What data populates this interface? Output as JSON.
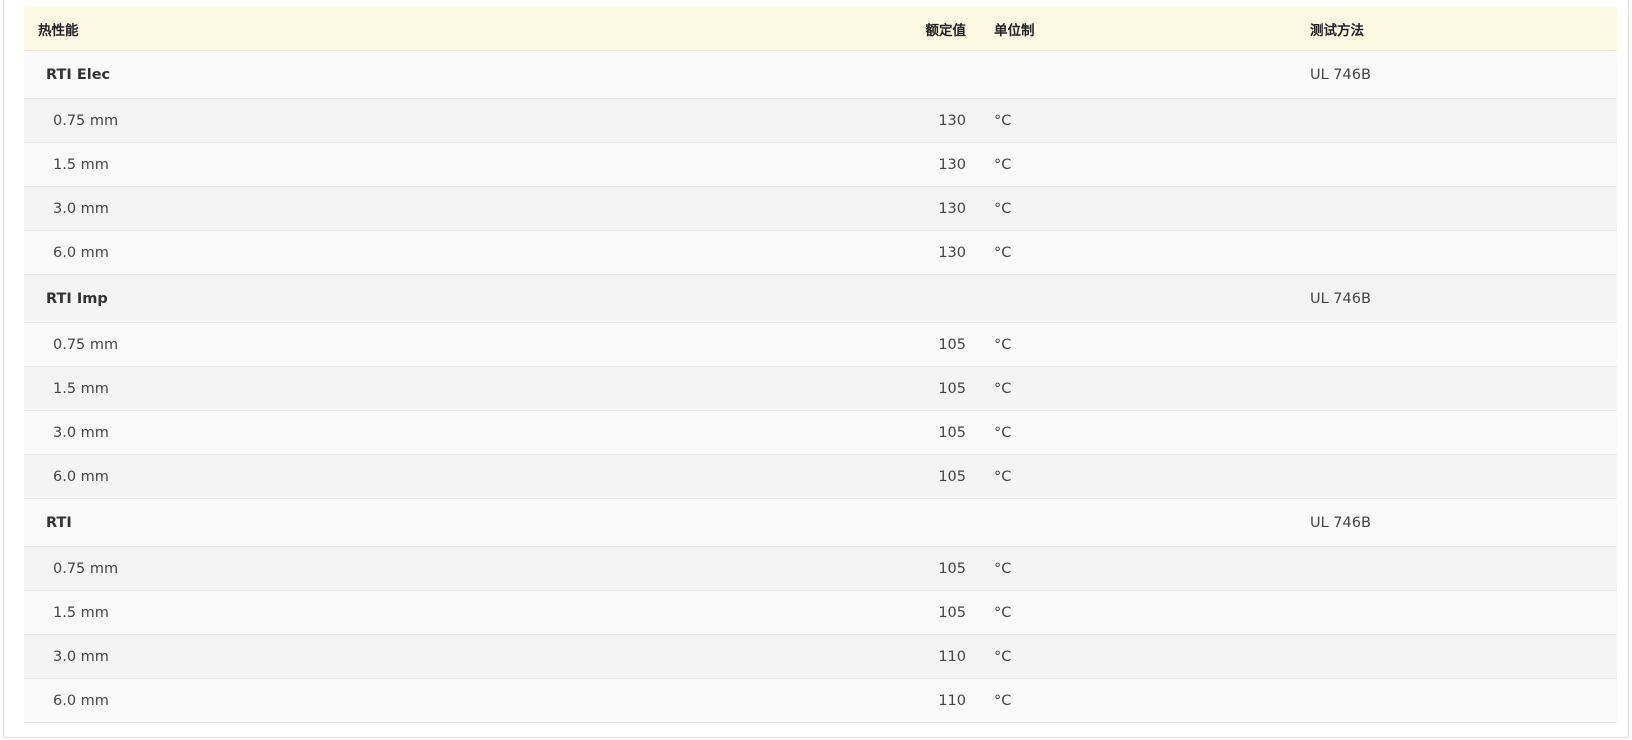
{
  "header": {
    "property": "热性能",
    "value": "额定值",
    "unit": "单位制",
    "method": "测试方法"
  },
  "groups": [
    {
      "name": "RTI Elec",
      "method": "UL 746B",
      "rows": [
        {
          "thickness": "0.75 mm",
          "value": "130",
          "unit": "°C"
        },
        {
          "thickness": "1.5 mm",
          "value": "130",
          "unit": "°C"
        },
        {
          "thickness": "3.0 mm",
          "value": "130",
          "unit": "°C"
        },
        {
          "thickness": "6.0 mm",
          "value": "130",
          "unit": "°C"
        }
      ]
    },
    {
      "name": "RTI Imp",
      "method": "UL 746B",
      "rows": [
        {
          "thickness": "0.75 mm",
          "value": "105",
          "unit": "°C"
        },
        {
          "thickness": "1.5 mm",
          "value": "105",
          "unit": "°C"
        },
        {
          "thickness": "3.0 mm",
          "value": "105",
          "unit": "°C"
        },
        {
          "thickness": "6.0 mm",
          "value": "105",
          "unit": "°C"
        }
      ]
    },
    {
      "name": "RTI",
      "method": "UL 746B",
      "rows": [
        {
          "thickness": "0.75 mm",
          "value": "105",
          "unit": "°C"
        },
        {
          "thickness": "1.5 mm",
          "value": "105",
          "unit": "°C"
        },
        {
          "thickness": "3.0 mm",
          "value": "110",
          "unit": "°C"
        },
        {
          "thickness": "6.0 mm",
          "value": "110",
          "unit": "°C"
        }
      ]
    }
  ]
}
